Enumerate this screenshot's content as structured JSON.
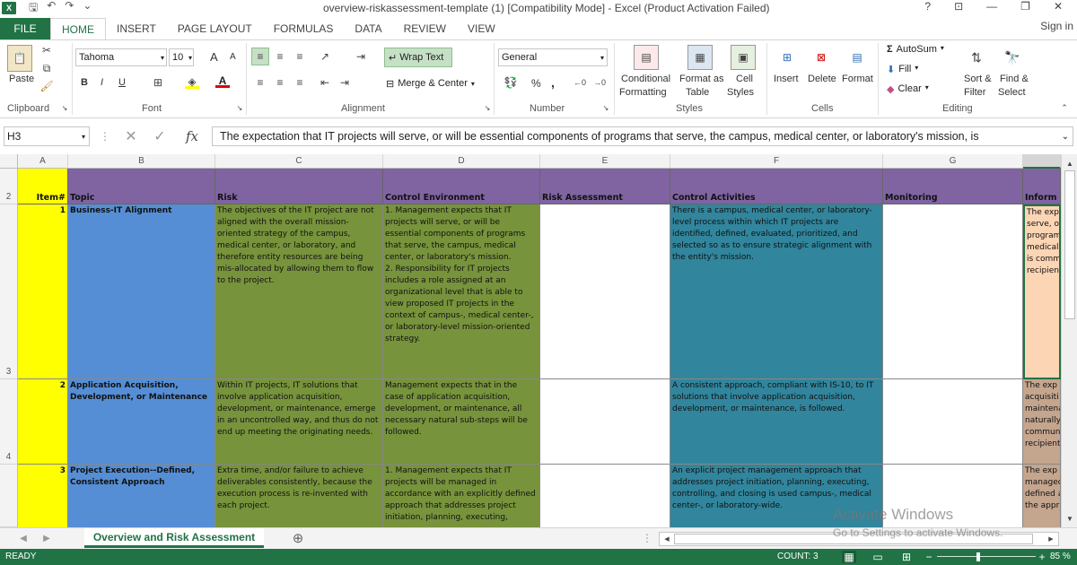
{
  "window": {
    "title": "overview-riskassessment-template (1)  [Compatibility Mode] - Excel (Product Activation Failed)",
    "controls": [
      "?",
      "⊡",
      "—",
      "❐",
      "✕"
    ]
  },
  "tabs": [
    "FILE",
    "HOME",
    "INSERT",
    "PAGE LAYOUT",
    "FORMULAS",
    "DATA",
    "REVIEW",
    "VIEW"
  ],
  "signin": "Sign in",
  "ribbon": {
    "clipboard": {
      "label": "Clipboard",
      "paste": "Paste"
    },
    "font": {
      "label": "Font",
      "name": "Tahoma",
      "size": "10",
      "bold": "B",
      "italic": "I",
      "underline": "U",
      "grow": "A",
      "shrink": "A"
    },
    "alignment": {
      "label": "Alignment",
      "wrap": "Wrap Text",
      "merge": "Merge & Center"
    },
    "number": {
      "label": "Number",
      "format": "General",
      "percent": "%",
      "comma": ","
    },
    "styles": {
      "label": "Styles",
      "conditional": [
        "Conditional",
        "Formatting"
      ],
      "format_table": [
        "Format as",
        "Table"
      ],
      "cell_styles": [
        "Cell",
        "Styles"
      ]
    },
    "cells": {
      "label": "Cells",
      "insert": "Insert",
      "delete": "Delete",
      "format": "Format"
    },
    "editing": {
      "label": "Editing",
      "autosum": "AutoSum",
      "fill": "Fill",
      "clear": "Clear",
      "sort": [
        "Sort &",
        "Filter"
      ],
      "find": [
        "Find &",
        "Select"
      ]
    }
  },
  "formula_bar": {
    "name_box": "H3",
    "fx": "fx",
    "content": "The expectation that IT projects will serve, or will be essential components of programs that serve, the campus, medical center, or laboratory's mission, is"
  },
  "columns": [
    "A",
    "B",
    "C",
    "D",
    "E",
    "F",
    "G"
  ],
  "rows": [
    "2",
    "3",
    "4"
  ],
  "headers": {
    "item": "Item#",
    "topic": "Topic",
    "risk": "Risk",
    "control_env": "Control Environment",
    "risk_assessment": "Risk Assessment",
    "control_activities": "Control Activities",
    "monitoring": "Monitoring",
    "info": "Inform"
  },
  "data_rows": [
    {
      "item": "1",
      "topic": "Business-IT Alignment",
      "risk": "The objectives of the IT project are not aligned with the overall mission-oriented strategy of the campus, medical center, or laboratory, and therefore entity resources are being mis-allocated by allowing them to flow to the project.",
      "control_env": "1. Management expects that IT projects will serve, or will be essential components of programs that serve, the campus, medical center, or laboratory's mission.\n2. Responsibility for IT projects includes a role assigned at an organizational level that is able to view proposed IT projects in the context of campus-, medical center-, or laboratory-level mission-oriented strategy.",
      "control_activities": "There is a campus, medical center, or laboratory-level process within which IT projects are identified, defined, evaluated, prioritized, and selected so as to ensure strategic alignment with the entity's mission.",
      "info": "The exp\nserve, o\nprogram\nmedical c\nis commu\nrecipient"
    },
    {
      "item": "2",
      "topic": "Application Acquisition, Development, or Maintenance",
      "risk": "Within IT projects, IT solutions that involve application acquisition, development, or maintenance, emerge in an uncontrolled way, and thus do not end up meeting the originating needs.",
      "control_env": "Management expects that in the case of application acquisition, development, or maintenance, all necessary natural sub-steps will be followed.",
      "control_activities": "A consistent approach, compliant with IS-10, to IT solutions that involve application acquisition, development, or maintenance, is followed.",
      "info": "The exp\nacquisiti\nmaintena\nnaturally\ncommuni\nrecipient"
    },
    {
      "item": "3",
      "topic": "Project Execution--Defined, Consistent Approach",
      "risk": "Extra time, and/or failure to achieve deliverables consistently, because the execution process is re-invented with each project.",
      "control_env": "1. Management expects that IT projects will be managed in accordance with an explicitly defined approach that addresses project initiation, planning, executing,",
      "control_activities": "An explicit project management approach that addresses project initiation, planning, executing, controlling, and closing is used campus-, medical center-, or laboratory-wide.",
      "info": "The exp\nmanaged\ndefined a\nthe appr"
    }
  ],
  "sheet": {
    "name": "Overview and Risk Assessment",
    "add": "⊕"
  },
  "watermark": {
    "line1": "Activate Windows",
    "line2": "Go to Settings to activate Windows."
  },
  "status": {
    "ready": "READY",
    "count": "COUNT: 3",
    "zoom": "85 %"
  },
  "colors": {
    "green": "#217346",
    "yellow": "#ffff00",
    "blue": "#558ed5",
    "olive": "#77933c",
    "teal": "#31859c",
    "purple": "#8064a2",
    "peach": "#fcd5b4"
  }
}
